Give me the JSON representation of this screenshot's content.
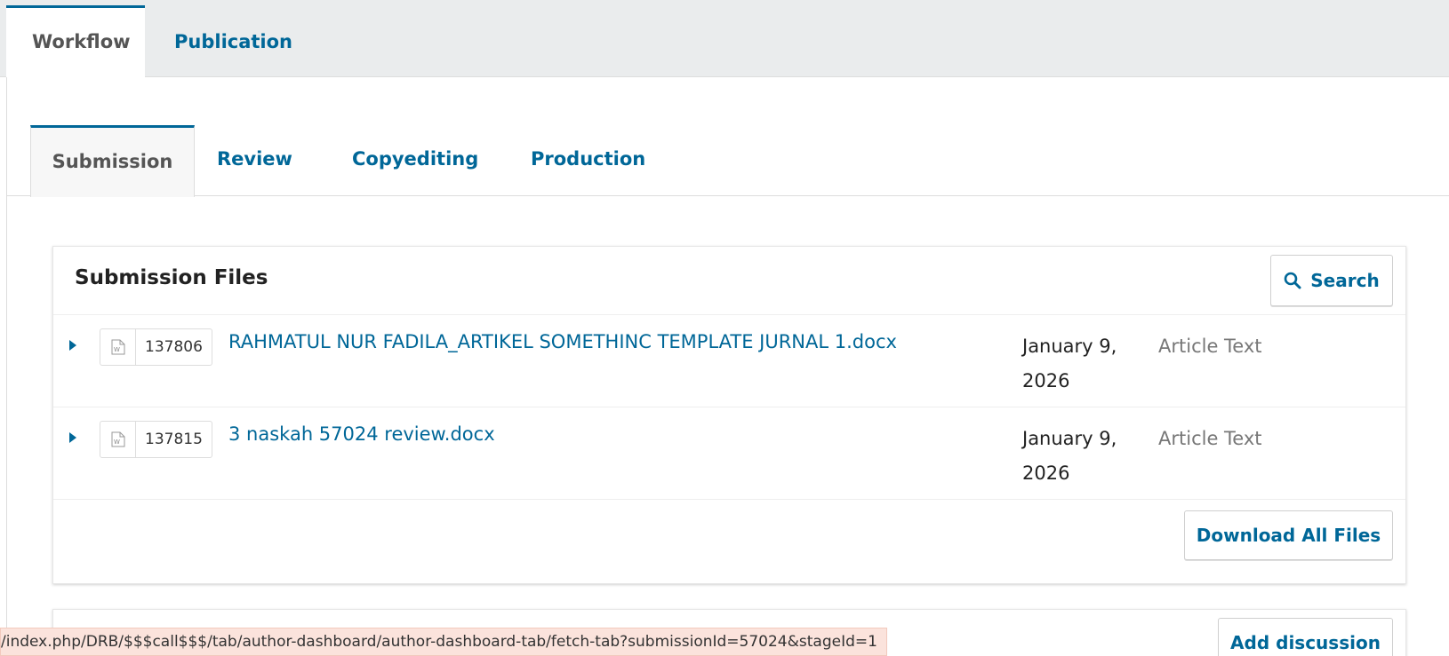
{
  "top_tabs": [
    {
      "label": "Workflow",
      "active": true
    },
    {
      "label": "Publication",
      "active": false
    }
  ],
  "stage_tabs": [
    {
      "label": "Submission",
      "active": true
    },
    {
      "label": "Review",
      "active": false
    },
    {
      "label": "Copyediting",
      "active": false
    },
    {
      "label": "Production",
      "active": false
    }
  ],
  "submission_files": {
    "title": "Submission Files",
    "search_label": "Search",
    "download_all_label": "Download All Files",
    "files": [
      {
        "id": "137806",
        "name": "RAHMATUL NUR FADILA_ARTIKEL SOMETHINC TEMPLATE JURNAL 1.docx",
        "date": "January 9, 2026",
        "genre": "Article Text",
        "file_type_icon": "word-document-icon"
      },
      {
        "id": "137815",
        "name": "3 naskah 57024 review.docx",
        "date": "January 9, 2026",
        "genre": "Article Text",
        "file_type_icon": "word-document-icon"
      }
    ]
  },
  "discussions": {
    "add_label": "Add discussion"
  },
  "status_bar": {
    "url": "/index.php/DRB/$$$call$$$/tab/author-dashboard/author-dashboard-tab/fetch-tab?submissionId=57024&stageId=1"
  },
  "colors": {
    "accent": "#006798",
    "tab_bar_bg": "#eaeced",
    "status_bar_bg": "#fbe3dc"
  }
}
